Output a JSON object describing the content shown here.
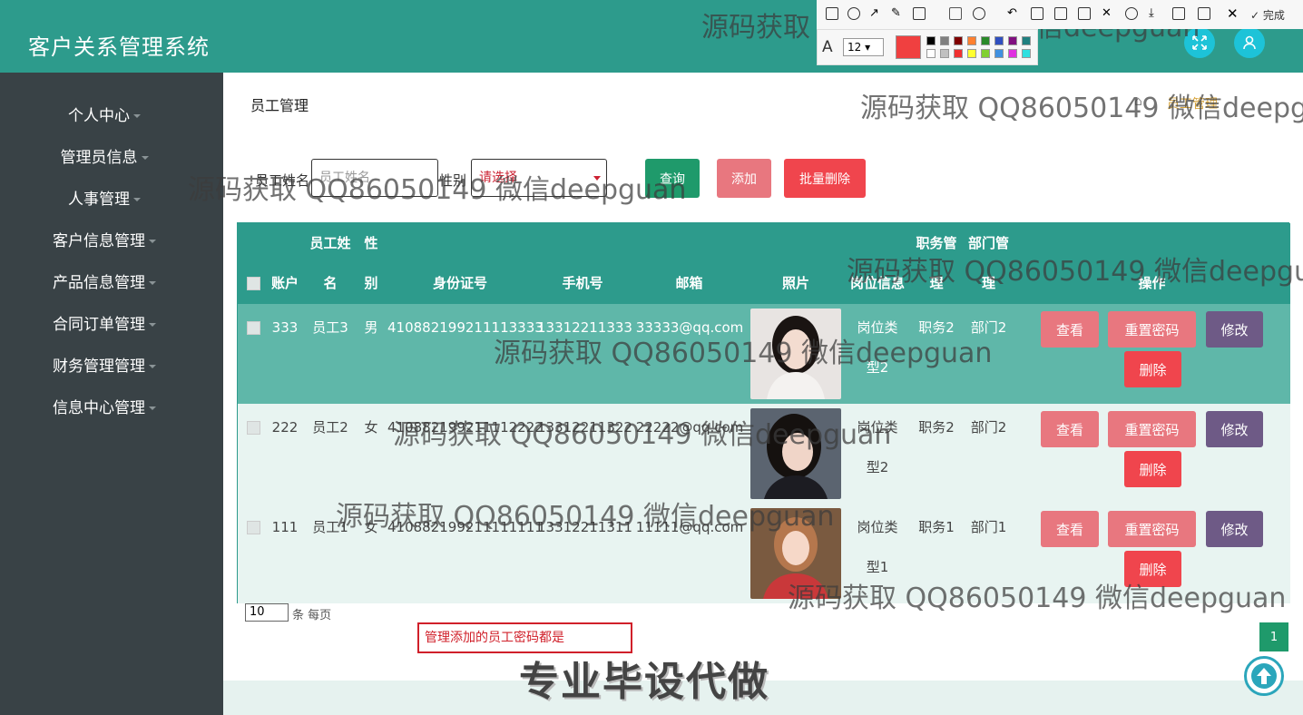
{
  "app": {
    "title": "客户关系管理系统"
  },
  "header": {
    "fullscreen_icon": "expand-icon",
    "user_icon": "user-icon"
  },
  "sidebar": {
    "items": [
      {
        "label": "个人中心"
      },
      {
        "label": "管理员信息"
      },
      {
        "label": "人事管理"
      },
      {
        "label": "客户信息管理"
      },
      {
        "label": "产品信息管理"
      },
      {
        "label": "合同订单管理"
      },
      {
        "label": "财务管理管理"
      },
      {
        "label": "信息中心管理"
      }
    ]
  },
  "page": {
    "title": "员工管理",
    "breadcrumb": "员工管理"
  },
  "search": {
    "name_label": "员工姓名",
    "name_placeholder": "员工姓名",
    "gender_label": "性别",
    "gender_value": "请选择",
    "query_label": "查询",
    "add_label": "添加",
    "batch_delete_label": "批量删除"
  },
  "table": {
    "headers": {
      "account": "账户",
      "name_top": "员工姓",
      "name_bottom": "名",
      "gender_top": "性",
      "gender_bottom": "别",
      "id_number": "身份证号",
      "phone": "手机号",
      "email": "邮箱",
      "photo": "照片",
      "position_info": "岗位信息",
      "duty_top": "职务管",
      "duty_bottom": "理",
      "dept_top": "部门管",
      "dept_bottom": "理",
      "actions": "操作"
    },
    "rows": [
      {
        "account": "333",
        "name": "员工3",
        "gender": "男",
        "id_number": "410882199211113333",
        "phone": "13312211333",
        "email": "33333@qq.com",
        "position_line1": "岗位类",
        "position_line2": "型2",
        "duty": "职务2",
        "dept": "部门2"
      },
      {
        "account": "222",
        "name": "员工2",
        "gender": "女",
        "id_number": "410882199211112222",
        "phone": "13312211322",
        "email": "22222@qq.com",
        "position_line1": "岗位类",
        "position_line2": "型2",
        "duty": "职务2",
        "dept": "部门2"
      },
      {
        "account": "111",
        "name": "员工1",
        "gender": "女",
        "id_number": "410882199211111111",
        "phone": "13312211311",
        "email": "11111@qq.com",
        "position_line1": "岗位类",
        "position_line2": "型1",
        "duty": "职务1",
        "dept": "部门1"
      }
    ],
    "row_actions": {
      "view": "查看",
      "reset": "重置密码",
      "edit": "修改",
      "delete": "删除"
    }
  },
  "pagination": {
    "page_size": "10",
    "per_page_label": "条 每页",
    "current_page": "1"
  },
  "note": {
    "text": "管理添加的员工密码都是"
  },
  "watermark": {
    "text": "源码获取 QQ86050149 微信deepguan",
    "stamp": "专业毕设代做"
  },
  "screenshot_toolbar": {
    "font_size": "12",
    "done_label": "完成",
    "selected_color": "#f04040"
  },
  "colors": {
    "header": "#2d9b8c",
    "sidebar": "#394246",
    "primary": "#1f9a6b",
    "danger": "#f0454d",
    "pink": "#e8777f",
    "purple": "#6e5a86"
  }
}
